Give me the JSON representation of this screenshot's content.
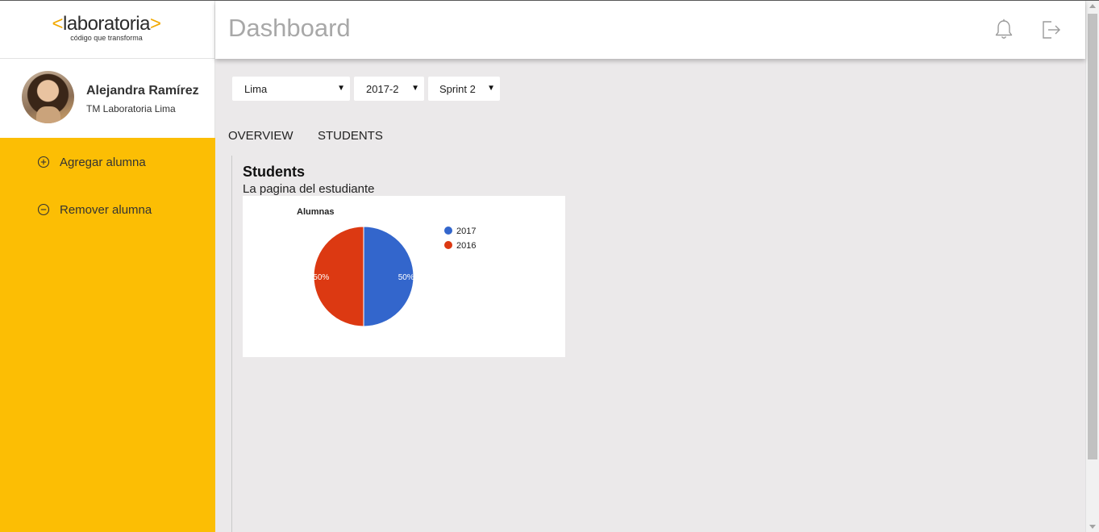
{
  "brand": {
    "logo_left": "<",
    "logo_text": "laboratoria",
    "logo_right": ">",
    "tagline": "código que transforma"
  },
  "profile": {
    "name": "Alejandra Ramírez",
    "role": "TM Laboratoria Lima"
  },
  "sidebar": {
    "items": [
      {
        "label": "Agregar alumna",
        "icon": "plus-circle-icon"
      },
      {
        "label": "Remover alumna",
        "icon": "minus-circle-icon"
      }
    ],
    "accent": "#fcbe04"
  },
  "header": {
    "title": "Dashboard",
    "icons": [
      "bell-icon",
      "logout-icon"
    ]
  },
  "filters": {
    "sede": "Lima",
    "generation": "2017-2",
    "sprint": "Sprint 2"
  },
  "tabs": [
    "OVERVIEW",
    "STUDENTS"
  ],
  "section": {
    "title": "Students",
    "subtitle": "La pagina del estudiante"
  },
  "chart_data": {
    "type": "pie",
    "title": "Alumnas",
    "categories": [
      "2017",
      "2016"
    ],
    "values": [
      50,
      50
    ],
    "colors": [
      "#3366cc",
      "#dc3912"
    ],
    "slice_labels": [
      "50%",
      "50%"
    ],
    "legend": "right"
  }
}
